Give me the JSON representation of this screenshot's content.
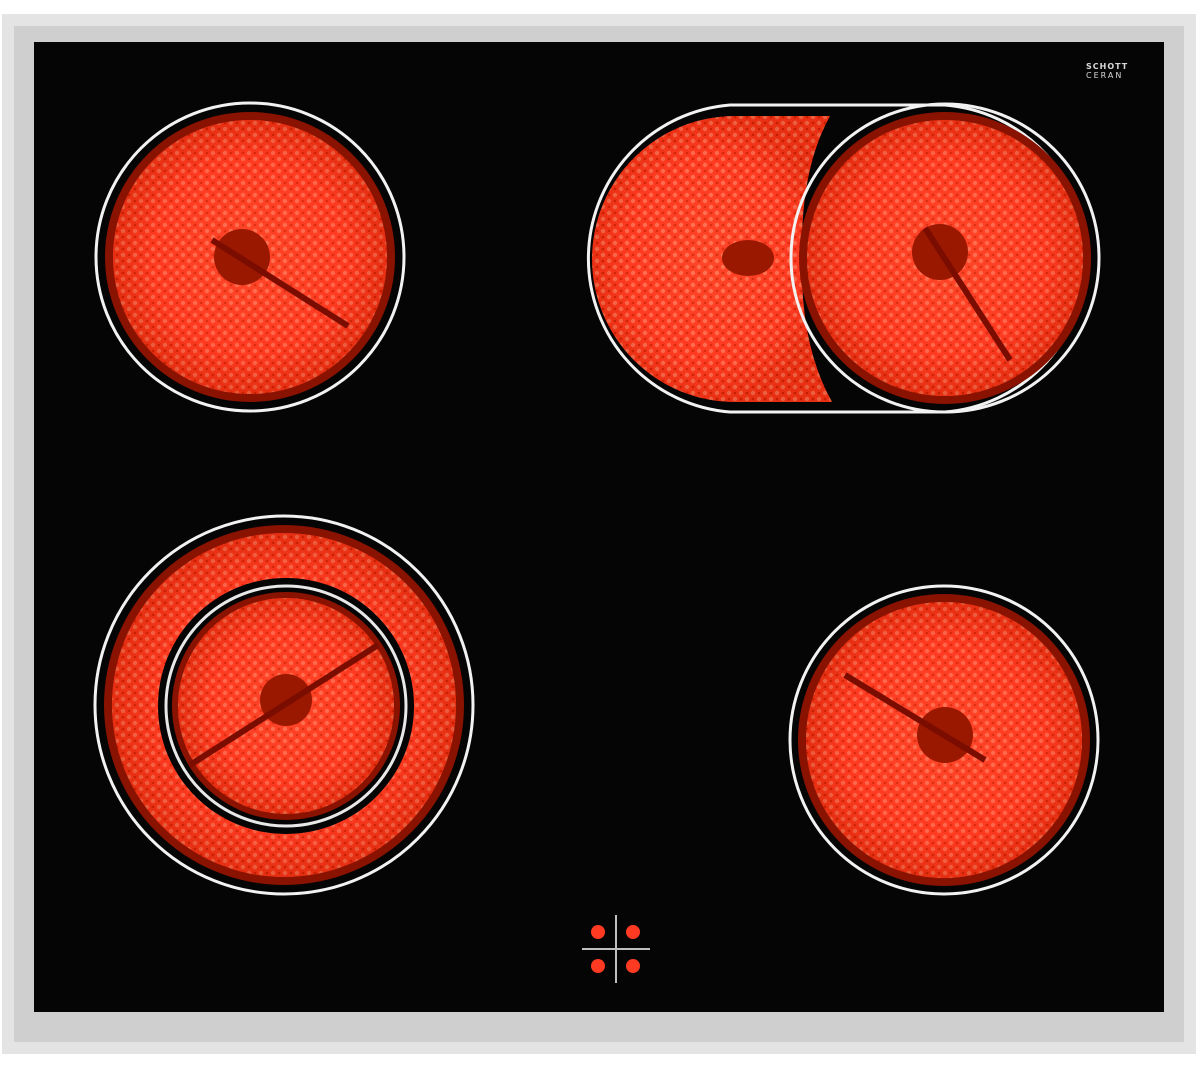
{
  "brand": {
    "line1": "SCHOTT",
    "line2": "CERAN"
  },
  "colors": {
    "frame": "#d6d6d6",
    "glass": "#050505",
    "coil_hot": "#ff3b22",
    "coil_dark": "#b81800",
    "ring": "#f2f2f2",
    "indicator": "#ff3a22"
  },
  "burners": [
    {
      "name": "burner-rear-left",
      "shape": "single-circle"
    },
    {
      "name": "burner-rear-right",
      "shape": "oval-extension"
    },
    {
      "name": "burner-front-left",
      "shape": "dual-ring"
    },
    {
      "name": "burner-front-right",
      "shape": "single-circle"
    }
  ],
  "indicator": {
    "icon": "four-zone-indicator-icon",
    "dots_lit": 4
  }
}
